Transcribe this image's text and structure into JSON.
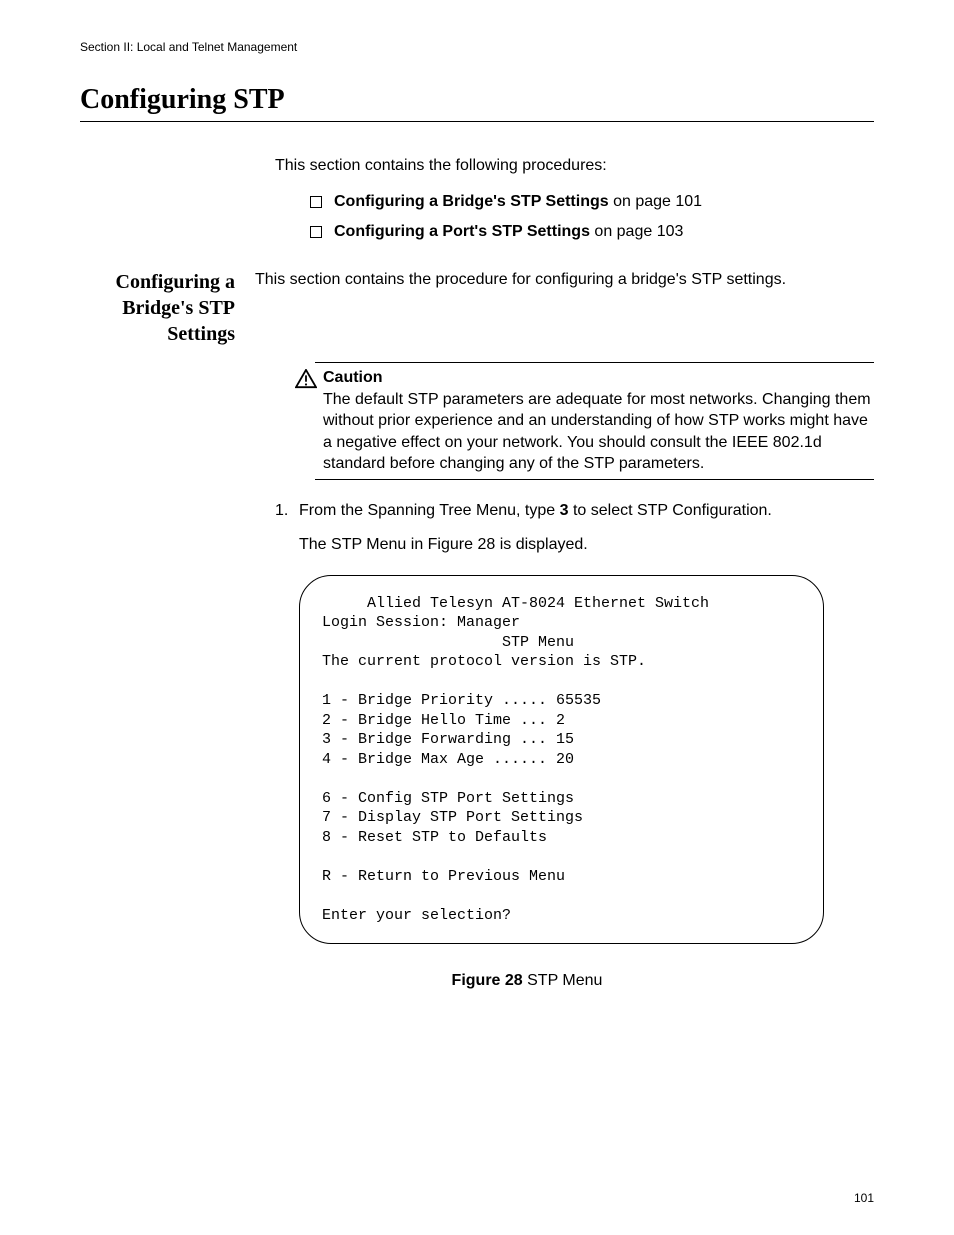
{
  "header": {
    "section_label": "Section II: Local and Telnet Management"
  },
  "title": "Configuring STP",
  "intro": "This section contains the following procedures:",
  "bullets": [
    {
      "bold": "Configuring a Bridge's STP Settings",
      "rest": " on page 101"
    },
    {
      "bold": "Configuring a Port's STP Settings",
      "rest": " on page 103"
    }
  ],
  "subsection": {
    "title_line1": "Configuring a",
    "title_line2": "Bridge's STP",
    "title_line3": "Settings",
    "body": "This section contains the procedure for configuring a bridge's STP settings."
  },
  "caution": {
    "title": "Caution",
    "body": "The default STP parameters are adequate for most networks. Changing them without prior experience and an understanding of how STP works might have a negative effect on your network. You should consult the IEEE 802.1d standard before changing any of the STP parameters."
  },
  "step1": {
    "num": "1.",
    "text_before": "From the Spanning Tree Menu, type ",
    "bold": "3",
    "text_after": " to select STP Configuration.",
    "followup": "The STP Menu in Figure 28 is displayed."
  },
  "terminal": {
    "line1": "     Allied Telesyn AT-8024 Ethernet Switch",
    "line2": "Login Session: Manager",
    "line3": "                    STP Menu",
    "line4": "The current protocol version is STP.",
    "line5": "1 - Bridge Priority ..... 65535",
    "line6": "2 - Bridge Hello Time ... 2",
    "line7": "3 - Bridge Forwarding ... 15",
    "line8": "4 - Bridge Max Age ...... 20",
    "line9": "6 - Config STP Port Settings",
    "line10": "7 - Display STP Port Settings",
    "line11": "8 - Reset STP to Defaults",
    "line12": "R - Return to Previous Menu",
    "line13": "Enter your selection?"
  },
  "figure": {
    "bold": "Figure 28",
    "rest": "  STP Menu"
  },
  "page_number": "101"
}
